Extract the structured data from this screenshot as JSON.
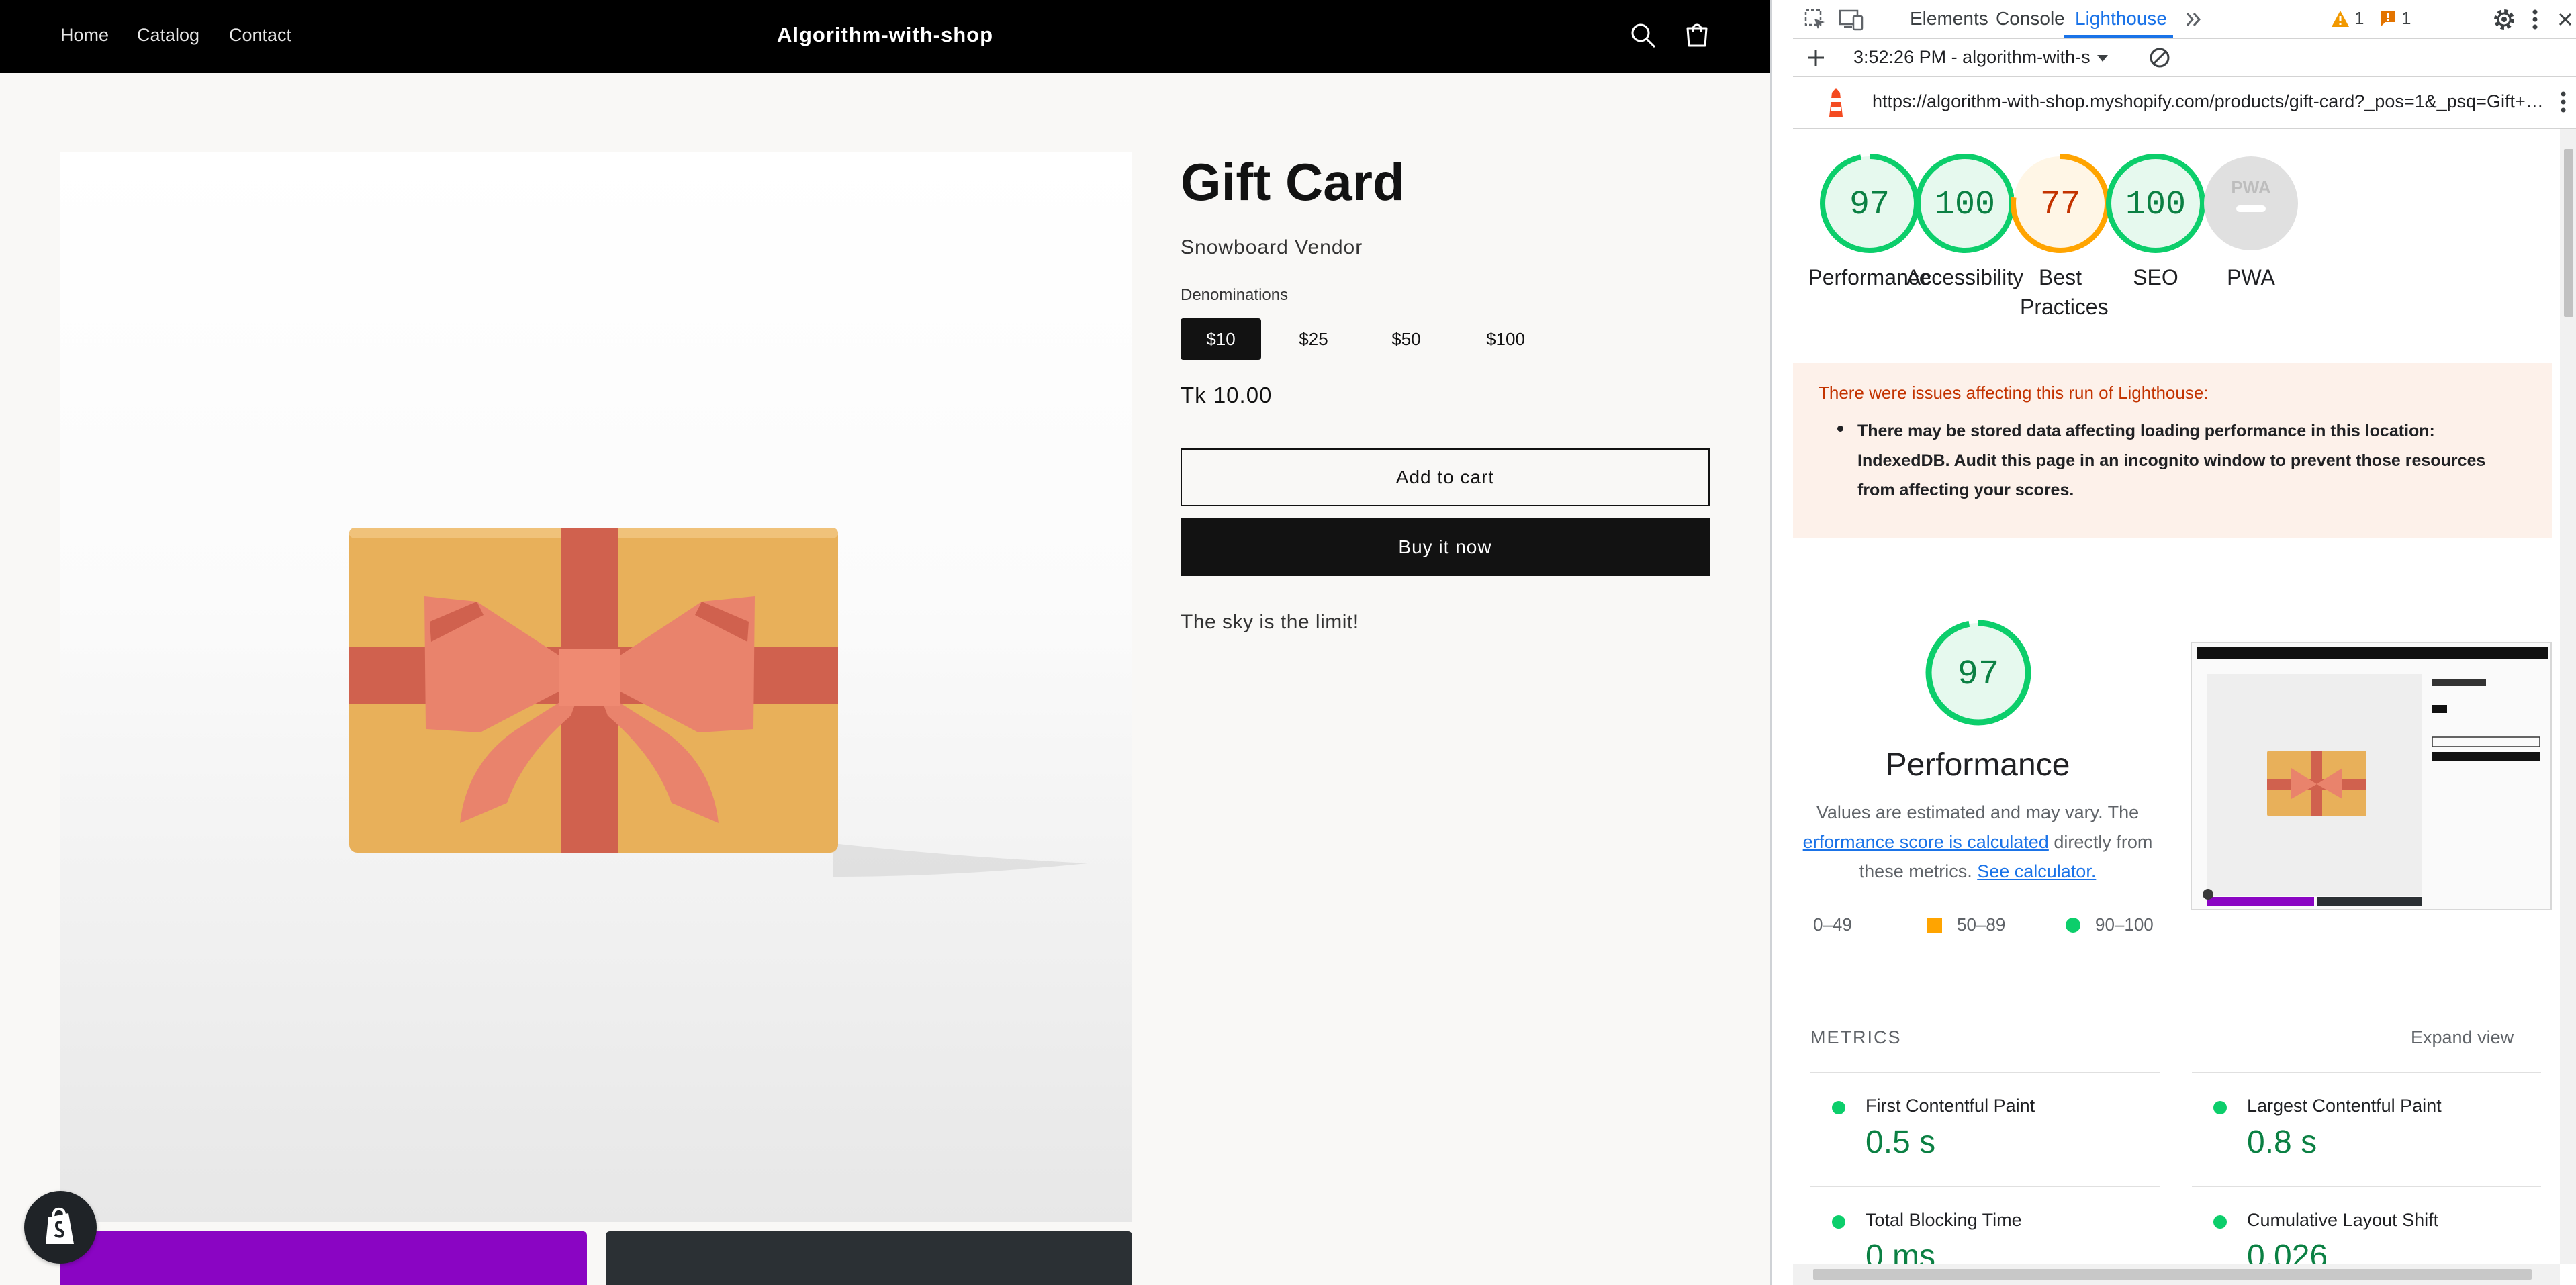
{
  "shop": {
    "nav": [
      "Home",
      "Catalog",
      "Contact"
    ],
    "title": "Algorithm-with-shop",
    "icons": [
      "search-icon",
      "cart-icon"
    ]
  },
  "product": {
    "title": "Gift Card",
    "vendor": "Snowboard Vendor",
    "denominations_label": "Denominations",
    "denominations": [
      "$10",
      "$25",
      "$50",
      "$100"
    ],
    "selected_denomination": "$10",
    "price": "Tk 10.00",
    "add_to_cart": "Add to cart",
    "buy_now": "Buy it now",
    "description": "The sky is the limit!"
  },
  "devtools": {
    "tabs": [
      "Elements",
      "Console",
      "Lighthouse"
    ],
    "active_tab": "Lighthouse",
    "warnings_count": "1",
    "issues_count": "1",
    "report_select": "3:52:26 PM - algorithm-with-s",
    "report_url": "https://algorithm-with-shop.myshopify.com/products/gift-card?_pos=1&_psq=Gift+C...",
    "scores": [
      {
        "label": "Performance",
        "value": "97",
        "score": 97,
        "status": "pass"
      },
      {
        "label": "Accessibility",
        "value": "100",
        "score": 100,
        "status": "pass"
      },
      {
        "label": "Best Practices",
        "value": "77",
        "score": 77,
        "status": "average"
      },
      {
        "label": "SEO",
        "value": "100",
        "score": 100,
        "status": "pass"
      },
      {
        "label": "PWA",
        "value": "PWA",
        "score": null,
        "status": "na"
      }
    ],
    "warning": {
      "title": "There were issues affecting this run of Lighthouse:",
      "item": "There may be stored data affecting loading performance in this location: IndexedDB. Audit this page in an incognito window to prevent those resources from affecting your scores."
    },
    "performance": {
      "score": "97",
      "heading": "Performance",
      "desc_before": "Values are estimated and may vary. The ",
      "desc_link": "erformance score is calculated",
      "desc_middle": " directly from these metrics. ",
      "desc_link2": "See calculator."
    },
    "legend": [
      "0–49",
      "50–89",
      "90–100"
    ],
    "metrics_title": "METRICS",
    "expand_view": "Expand view",
    "metrics": [
      {
        "name": "First Contentful Paint",
        "value": "0.5 s"
      },
      {
        "name": "Largest Contentful Paint",
        "value": "0.8 s"
      },
      {
        "name": "Total Blocking Time",
        "value": "0 ms"
      },
      {
        "name": "Cumulative Layout Shift",
        "value": "0.026"
      }
    ]
  },
  "colors": {
    "pass": "#0cce6b",
    "average": "#ffa400",
    "fail": "#ff4e42",
    "na": "#cccccc",
    "accent": "#1a73e8",
    "thumb_purple": "#8a05c3"
  }
}
